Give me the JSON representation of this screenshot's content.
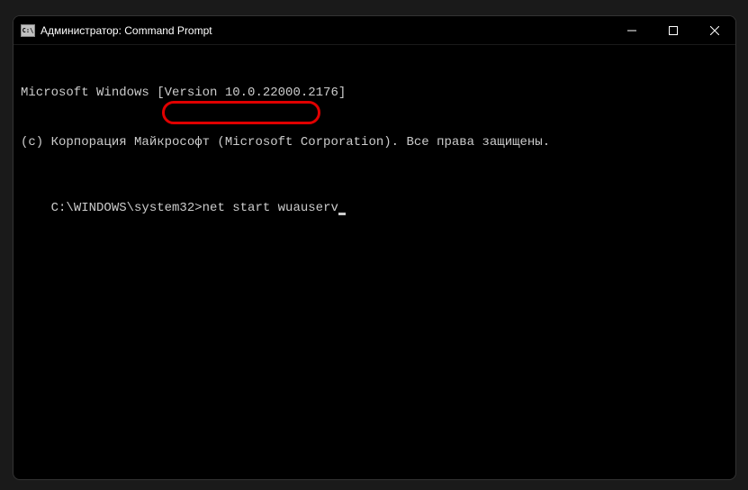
{
  "titlebar": {
    "icon_label": "C:\\",
    "title": "Администратор: Command Prompt"
  },
  "terminal": {
    "line1": "Microsoft Windows [Version 10.0.22000.2176]",
    "line2": "(c) Корпорация Майкрософт (Microsoft Corporation). Все права защищены.",
    "blank": "",
    "prompt": "C:\\WINDOWS\\system32>",
    "command": "net start wuauserv"
  }
}
